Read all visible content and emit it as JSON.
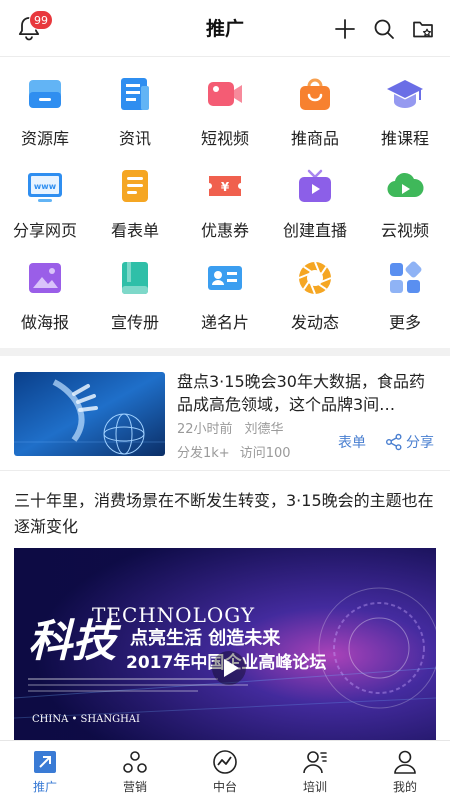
{
  "header": {
    "title": "推广",
    "badge_count": "99",
    "icons": [
      "bell-icon",
      "plus-icon",
      "search-icon",
      "folder-star-icon"
    ]
  },
  "grid": [
    {
      "label": "资源库",
      "icon": "resource-library-icon",
      "color": "#3b9ef0"
    },
    {
      "label": "资讯",
      "icon": "news-icon",
      "color": "#2f8ef0"
    },
    {
      "label": "短视频",
      "icon": "short-video-icon",
      "color": "#f45c74"
    },
    {
      "label": "推商品",
      "icon": "shopping-bag-icon",
      "color": "#f7812f"
    },
    {
      "label": "推课程",
      "icon": "graduation-cap-icon",
      "color": "#6a6ee6"
    },
    {
      "label": "分享网页",
      "icon": "webpage-icon",
      "color": "#2f8ef0"
    },
    {
      "label": "看表单",
      "icon": "form-icon",
      "color": "#f5a623"
    },
    {
      "label": "优惠券",
      "icon": "coupon-icon",
      "color": "#f0604e"
    },
    {
      "label": "创建直播",
      "icon": "live-tv-icon",
      "color": "#8c5fe8"
    },
    {
      "label": "云视频",
      "icon": "cloud-video-icon",
      "color": "#3fb85a"
    },
    {
      "label": "做海报",
      "icon": "poster-icon",
      "color": "#9a5ee8"
    },
    {
      "label": "宣传册",
      "icon": "brochure-icon",
      "color": "#2fbfa8"
    },
    {
      "label": "递名片",
      "icon": "business-card-icon",
      "color": "#3b9ef0"
    },
    {
      "label": "发动态",
      "icon": "aperture-icon",
      "color": "#f5a623"
    },
    {
      "label": "更多",
      "icon": "more-grid-icon",
      "color": "#5a8ff0"
    }
  ],
  "article": {
    "title": "盘点3·15晚会30年大数据，食品药品成高危领域，这个品牌3间…",
    "time": "22小时前",
    "author": "刘德华",
    "shares": "分发1k+",
    "visits": "访问100",
    "form_label": "表单",
    "share_label": "分享"
  },
  "post": {
    "text": "三十年里，消费场景在不断发生转变，3·15晚会的主题也在逐渐变化",
    "image": {
      "heading_en": "TECHNOLOGY",
      "heading_cn": "科技",
      "slogan": "点亮生活 创造未来",
      "subtitle": "2017年中国企业高峰论坛",
      "location": "CHINA • SHANGHAI"
    }
  },
  "tabs": [
    {
      "label": "推广",
      "icon": "promote-icon",
      "active": true
    },
    {
      "label": "营销",
      "icon": "marketing-icon",
      "active": false
    },
    {
      "label": "中台",
      "icon": "dashboard-icon",
      "active": false
    },
    {
      "label": "培训",
      "icon": "training-icon",
      "active": false
    },
    {
      "label": "我的",
      "icon": "profile-icon",
      "active": false
    }
  ],
  "colors": {
    "accent": "#3a7bd5",
    "badge": "#e8383d",
    "link": "#4a7fd0"
  }
}
